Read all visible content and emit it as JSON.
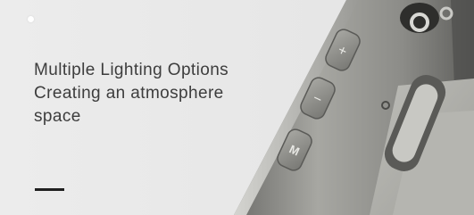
{
  "banner": {
    "headline_lines": [
      "Multiple Lighting Options",
      "Creating an atmosphere",
      "space"
    ],
    "button_glyphs": {
      "plus": "+",
      "minus": "−",
      "mode": "M"
    }
  },
  "colors": {
    "background": "#e9e9e9",
    "text": "#3d3d3d",
    "dash": "#1f1f1f",
    "device_body": "#8a8a86"
  }
}
